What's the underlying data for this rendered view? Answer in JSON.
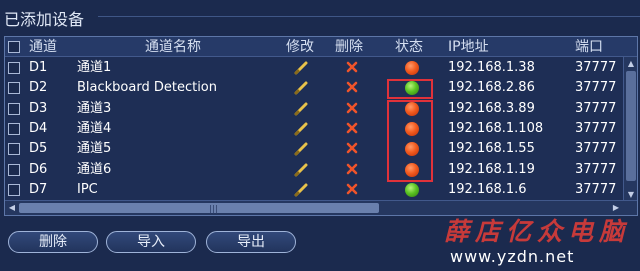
{
  "panel_title": "已添加设备",
  "columns": {
    "channel": "通道",
    "name": "通道名称",
    "edit": "修改",
    "delete": "删除",
    "status": "状态",
    "ip": "IP地址",
    "port": "端口"
  },
  "rows": [
    {
      "channel": "D1",
      "name": "通道1",
      "status": "red",
      "ip": "192.168.1.38",
      "port": "37777"
    },
    {
      "channel": "D2",
      "name": "Blackboard Detection",
      "status": "green",
      "ip": "192.168.2.86",
      "port": "37777"
    },
    {
      "channel": "D3",
      "name": "通道3",
      "status": "red",
      "ip": "192.168.3.89",
      "port": "37777"
    },
    {
      "channel": "D4",
      "name": "通道4",
      "status": "red",
      "ip": "192.168.1.108",
      "port": "37777"
    },
    {
      "channel": "D5",
      "name": "通道5",
      "status": "red",
      "ip": "192.168.1.55",
      "port": "37777"
    },
    {
      "channel": "D6",
      "name": "通道6",
      "status": "red",
      "ip": "192.168.1.19",
      "port": "37777"
    },
    {
      "channel": "D7",
      "name": "IPC",
      "status": "green",
      "ip": "192.168.1.6",
      "port": "37777"
    }
  ],
  "status_colors": {
    "red": "#f25b1f",
    "green": "#5bc423"
  },
  "highlight_color": "#e0323a",
  "buttons": {
    "delete": "删除",
    "import": "导入",
    "export": "导出"
  },
  "watermark": {
    "text": "薛店亿众电脑",
    "url": "www.yzdn.net"
  }
}
